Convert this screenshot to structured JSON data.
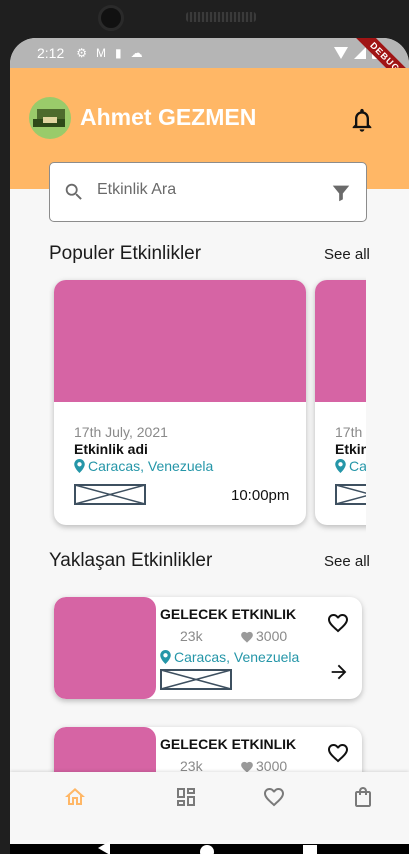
{
  "status_bar": {
    "time": "2:12",
    "icons": [
      "gear-icon",
      "gmail-icon",
      "sd-card-icon",
      "cloud-icon"
    ]
  },
  "debug_banner": "DEBUG",
  "header": {
    "user_name": "Ahmet GEZMEN",
    "background_color": "#ffb766"
  },
  "search": {
    "placeholder": "Etkinlik Ara"
  },
  "popular": {
    "title": "Populer Etkinlikler",
    "see_all": "See all",
    "cards": [
      {
        "date": "17th July, 2021",
        "name": "Etkinlik adi",
        "location": "Caracas, Venezuela",
        "time": "10:00pm"
      },
      {
        "date": "17th",
        "name": "Etkin",
        "location": "Ca"
      }
    ]
  },
  "upcoming": {
    "title": "Yaklaşan Etkinlikler",
    "see_all": "See all",
    "items": [
      {
        "title": "GELECEK ETKINLIK",
        "count": "23k",
        "likes": "3000",
        "location": "Caracas, Venezuela"
      },
      {
        "title": "GELECEK ETKINLIK",
        "count": "23k",
        "likes": "3000"
      }
    ]
  },
  "bottom_nav": {
    "items": [
      "home-icon",
      "dashboard-icon",
      "favorites-icon",
      "shopping-bag-icon"
    ],
    "active_color": "#ffb766"
  },
  "colors": {
    "accent": "#ffb766",
    "image_placeholder": "#d664a4",
    "location": "#2596a8"
  }
}
